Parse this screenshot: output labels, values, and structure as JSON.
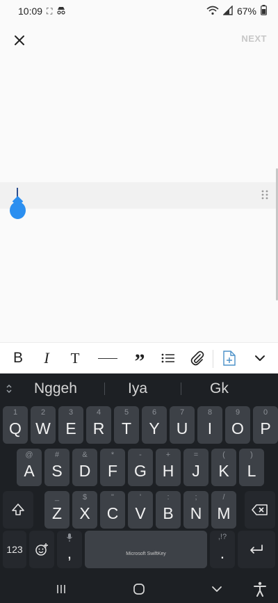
{
  "status_bar": {
    "time": "10:09",
    "battery": "67%"
  },
  "app_bar": {
    "next_label": "NEXT"
  },
  "suggestions": [
    "Nggeh",
    "Iya",
    "Gk"
  ],
  "keyboard": {
    "row1": [
      {
        "k": "Q",
        "h": "1"
      },
      {
        "k": "W",
        "h": "2"
      },
      {
        "k": "E",
        "h": "3"
      },
      {
        "k": "R",
        "h": "4"
      },
      {
        "k": "T",
        "h": "5"
      },
      {
        "k": "Y",
        "h": "6"
      },
      {
        "k": "U",
        "h": "7"
      },
      {
        "k": "I",
        "h": "8"
      },
      {
        "k": "O",
        "h": "9"
      },
      {
        "k": "P",
        "h": "0"
      }
    ],
    "row2": [
      {
        "k": "A",
        "h": "@"
      },
      {
        "k": "S",
        "h": "#"
      },
      {
        "k": "D",
        "h": "&"
      },
      {
        "k": "F",
        "h": "*"
      },
      {
        "k": "G",
        "h": "-"
      },
      {
        "k": "H",
        "h": "+"
      },
      {
        "k": "J",
        "h": "="
      },
      {
        "k": "K",
        "h": "("
      },
      {
        "k": "L",
        "h": ")"
      }
    ],
    "row3": [
      {
        "k": "Z",
        "h": "_"
      },
      {
        "k": "X",
        "h": "$"
      },
      {
        "k": "C",
        "h": "\""
      },
      {
        "k": "V",
        "h": "'"
      },
      {
        "k": "B",
        "h": ":"
      },
      {
        "k": "N",
        "h": ";"
      },
      {
        "k": "M",
        "h": "/"
      }
    ],
    "numbers_label": "123",
    "comma_label": ",",
    "period_label": ".",
    "period_hint": ",!?",
    "space_label": "Microsoft SwiftKey"
  },
  "colors": {
    "accent": "#2b8ff0",
    "keyboard_bg": "#1d2024",
    "key_bg": "#3d4147"
  },
  "icons": {
    "close": "close-icon",
    "bold": "bold-icon",
    "italic": "italic-icon",
    "text_style": "text-style-icon",
    "divider": "horizontal-rule-icon",
    "quote": "quote-icon",
    "list": "bulleted-list-icon",
    "attach": "paperclip-icon",
    "document": "add-document-icon",
    "collapse": "chevron-down-icon",
    "shift": "shift-icon",
    "backspace": "backspace-icon",
    "emoji": "emoji-icon",
    "mic": "mic-icon",
    "enter": "enter-icon",
    "recents": "recent-apps-icon",
    "home": "home-icon",
    "back": "back-icon",
    "accessibility": "accessibility-icon"
  }
}
